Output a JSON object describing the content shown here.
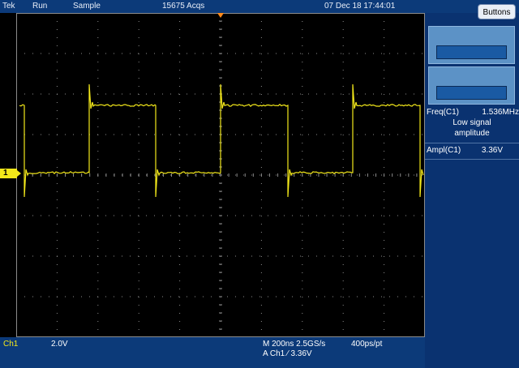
{
  "header": {
    "brand": "Tek",
    "run_state": "Run",
    "acq_mode": "Sample",
    "acq_count": "15675 Acqs",
    "datetime": "07 Dec 18 17:44:01"
  },
  "side_panel": {
    "buttons_label": "Buttons",
    "measurements": [
      {
        "label": "Freq(C1)",
        "value": "1.536MHz",
        "note_line1": "Low signal",
        "note_line2": "amplitude"
      },
      {
        "label": "Ampl(C1)",
        "value": "3.36V"
      }
    ]
  },
  "channel_marker": "1",
  "footer": {
    "channel": "Ch1",
    "volts_per_div": "2.0V",
    "timebase": "M 200ns 2.5GS/s",
    "record": "400ps/pt",
    "trigger": "A  Ch1  ∕  3.36V"
  },
  "colors": {
    "trace": "#f3e81a",
    "panel": "#0c3a79",
    "grid": "#8c8c8c",
    "trigger_marker": "#ff8a1a"
  },
  "icons": [
    "trigger-position-icon",
    "channel-ground-marker-icon",
    "rising-edge-icon"
  ]
}
